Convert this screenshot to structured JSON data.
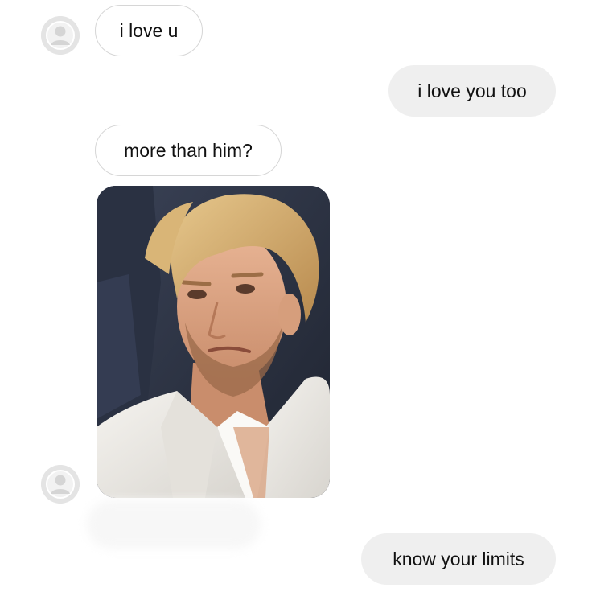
{
  "messages": [
    {
      "from": "them",
      "text": "i love u"
    },
    {
      "from": "me",
      "text": "i love you too"
    },
    {
      "from": "them",
      "text": "more than him?"
    },
    {
      "from": "them",
      "image": "photo-of-blond-man-in-white-suit"
    },
    {
      "from": "them",
      "text": "",
      "blurred": true
    },
    {
      "from": "me",
      "text": "know your limits"
    }
  ],
  "icons": {
    "avatar": "user-avatar-placeholder-icon"
  },
  "colors": {
    "background": "#ffffff",
    "incoming_bubble_border": "#d6d6d6",
    "outgoing_bubble_fill": "#efefef",
    "text": "#111111",
    "avatar_fill": "#e4e4e4"
  }
}
